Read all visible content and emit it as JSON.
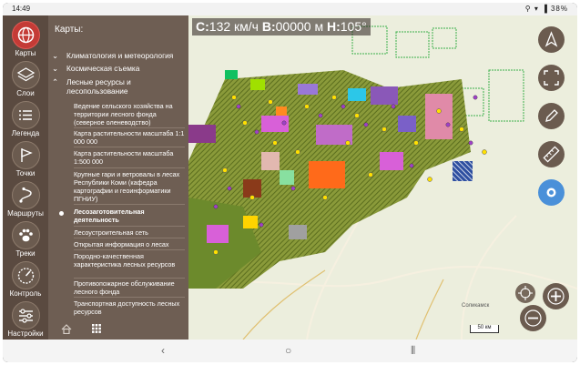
{
  "status": {
    "time": "14:49",
    "battery": "38%"
  },
  "hud": {
    "c_label": "C:",
    "speed": "132 км/ч",
    "b_label": "B:",
    "elev": "00000 м",
    "h_label": "H:",
    "heading": "105°"
  },
  "rail": {
    "items": [
      {
        "label": "Карты",
        "icon": "globe-icon"
      },
      {
        "label": "Слои",
        "icon": "layers-icon"
      },
      {
        "label": "Легенда",
        "icon": "list-icon"
      },
      {
        "label": "Точки",
        "icon": "flag-icon"
      },
      {
        "label": "Маршруты",
        "icon": "route-icon"
      },
      {
        "label": "Треки",
        "icon": "paw-icon"
      },
      {
        "label": "Контроль",
        "icon": "gauge-icon"
      },
      {
        "label": "Настройки",
        "icon": "sliders-icon"
      }
    ]
  },
  "panel": {
    "title": "Карты:",
    "categories": [
      {
        "label": "Климатология и метеорология"
      },
      {
        "label": "Космическая съемка"
      },
      {
        "label": "Лесные ресурсы и лесопользование"
      }
    ],
    "subitems": [
      {
        "label": "Ведение сельского хозяйства на территории лесного фонда (северное оленеводство)"
      },
      {
        "label": "Карта растительности масштаба 1:1 000 000"
      },
      {
        "label": "Карта растительности масштаба 1:500 000"
      },
      {
        "label": "Крупные гари и ветровалы в лесах Республики Коми (кафедра картографии и геоинформатики ПГНИУ)"
      },
      {
        "label": "Лесозаготовительная деятельность"
      },
      {
        "label": "Лесоустроительная сеть"
      },
      {
        "label": "Открытая информация о лесах"
      },
      {
        "label": "Породно-качественная характеристика лесных ресурсов"
      },
      {
        "label": "Противопожарное обслуживание лесного фонда"
      },
      {
        "label": "Транспортная доступность лесных ресурсов"
      }
    ]
  },
  "map": {
    "scale_label": "50 км",
    "place_label": "Соликамск"
  },
  "colors": {
    "rail": "#5a4a40",
    "panel": "#6e5e53",
    "active": "#c43b36",
    "accent_blue": "#4a90d9"
  }
}
